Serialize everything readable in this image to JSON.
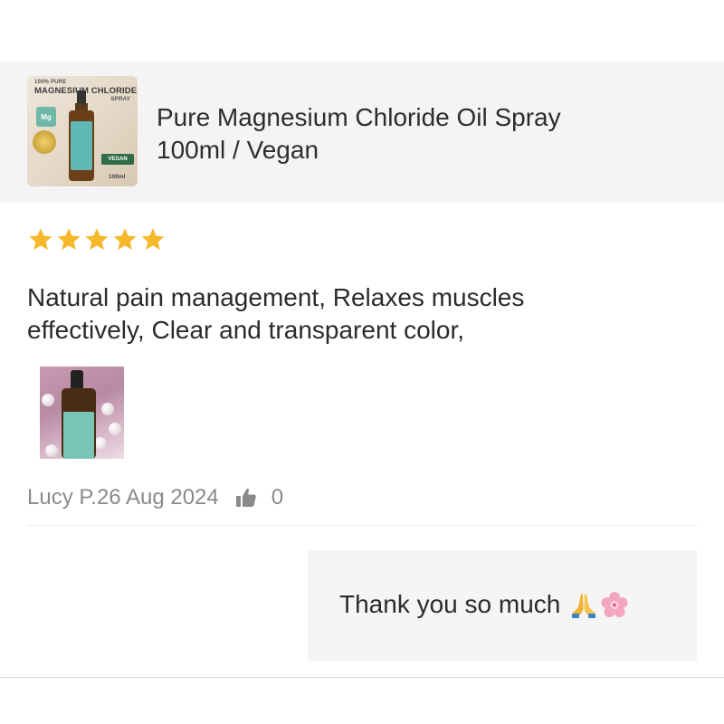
{
  "product": {
    "thumbnail": {
      "line1": "100% PURE",
      "line2": "MAGNESIUM CHLORIDE",
      "line3": "SPRAY",
      "badge": "Mg",
      "vegan": "VEGAN",
      "volume": "100ml"
    },
    "title_line1": "Pure Magnesium Chloride Oil Spray",
    "title_line2": "100ml / Vegan"
  },
  "review": {
    "rating": 5,
    "rating_max": 5,
    "star_color": "#f6b92b",
    "text_line1": "Natural pain management, Relaxes muscles",
    "text_line2": "effectively, Clear and transparent color,",
    "author": "Lucy P.",
    "date": "26 Aug 2024",
    "like_icon": "thumbs-up-icon",
    "likes": "0"
  },
  "seller_reply": {
    "text": "Thank you so much",
    "emojis": [
      "folded-hands-icon",
      "cherry-blossom-icon"
    ]
  }
}
